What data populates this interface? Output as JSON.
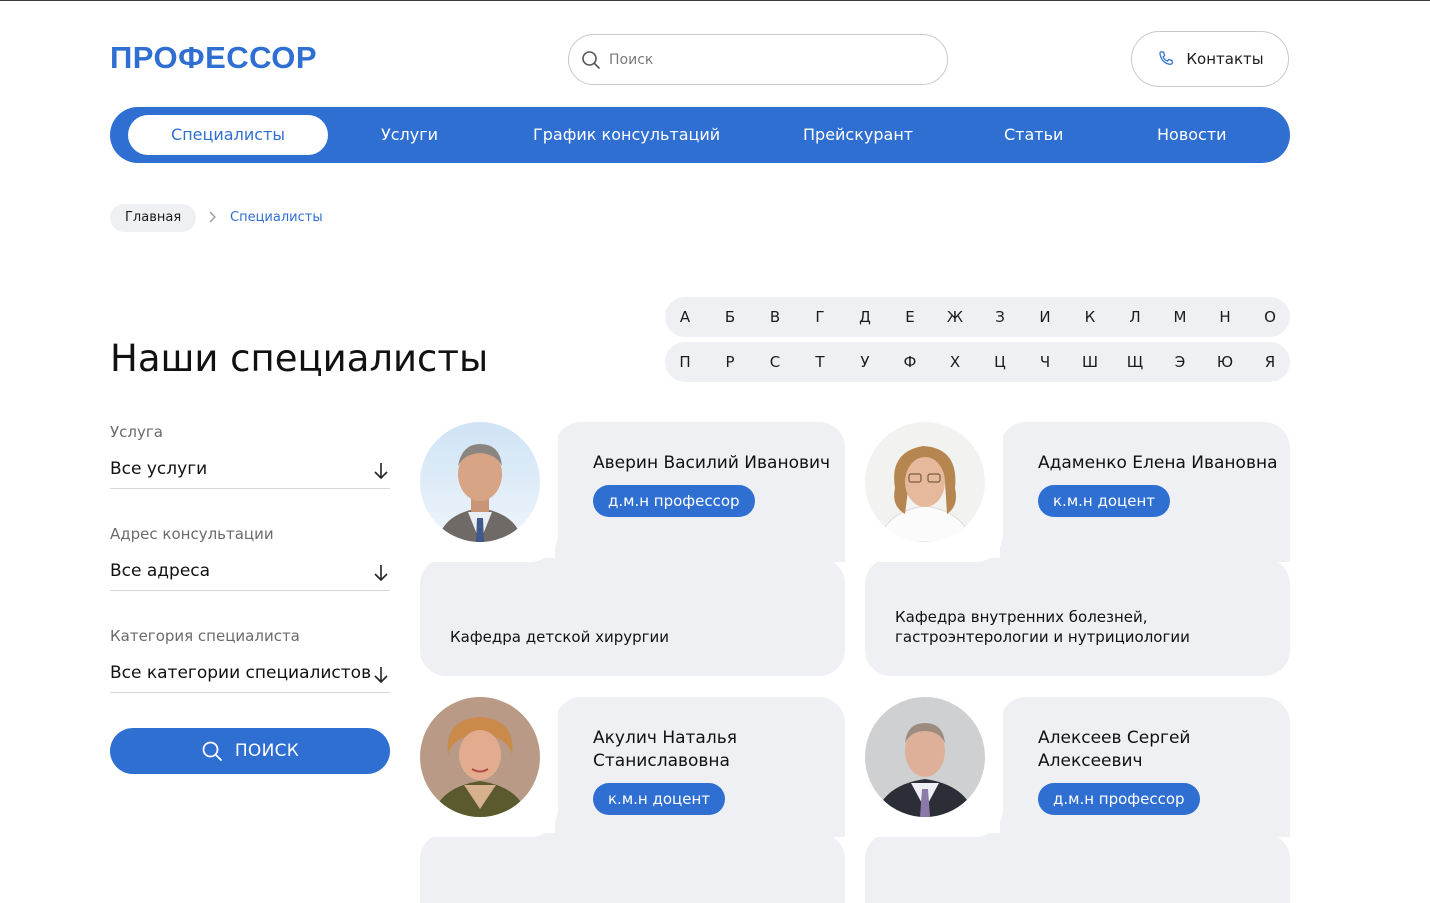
{
  "brand": {
    "logo": "ПРОФЕССОР",
    "accent": "#2f6fd2"
  },
  "search": {
    "placeholder": "Поиск"
  },
  "contacts": {
    "label": "Контакты"
  },
  "nav": {
    "items": [
      {
        "label": "Специалисты",
        "active": true
      },
      {
        "label": "Услуги"
      },
      {
        "label": "График консультаций"
      },
      {
        "label": "Прейскурант"
      },
      {
        "label": "Статьи"
      },
      {
        "label": "Новости"
      }
    ]
  },
  "breadcrumb": {
    "home": "Главная",
    "current": "Специалисты"
  },
  "page": {
    "title": "Наши специалисты"
  },
  "alphabet": {
    "row1": [
      "А",
      "Б",
      "В",
      "Г",
      "Д",
      "Е",
      "Ж",
      "З",
      "И",
      "К",
      "Л",
      "М",
      "Н",
      "О"
    ],
    "row2": [
      "П",
      "Р",
      "С",
      "Т",
      "У",
      "Ф",
      "Х",
      "Ц",
      "Ч",
      "Ш",
      "Щ",
      "Э",
      "Ю",
      "Я"
    ]
  },
  "filters": {
    "service": {
      "label": "Услуга",
      "value": "Все услуги"
    },
    "address": {
      "label": "Адрес консультации",
      "value": "Все адреса"
    },
    "category": {
      "label": "Категория специалиста",
      "value": "Все категории специалистов"
    },
    "search_button": "ПОИСК"
  },
  "specialists": [
    {
      "name": "Аверин Василий Иванович",
      "title": "д.м.н профессор",
      "department": "Кафедра детской хирургии"
    },
    {
      "name": "Адаменко Елена Ивановна",
      "title": "к.м.н доцент",
      "department": "Кафедра внутренних болезней, гастроэнтерологии и нутрициологии"
    },
    {
      "name": "Акулич Наталья Станиславовна",
      "title": "к.м.н доцент",
      "department": ""
    },
    {
      "name": "Алексеев Сергей Алексеевич",
      "title": "д.м.н профессор",
      "department": ""
    }
  ]
}
